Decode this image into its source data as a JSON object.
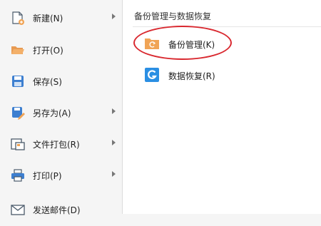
{
  "menu": {
    "items": [
      {
        "label": "新建(N)",
        "icon": "new-doc-icon",
        "has_submenu": true
      },
      {
        "label": "打开(O)",
        "icon": "open-folder-icon",
        "has_submenu": false
      },
      {
        "label": "保存(S)",
        "icon": "save-icon",
        "has_submenu": false
      },
      {
        "label": "另存为(A)",
        "icon": "save-as-icon",
        "has_submenu": true
      },
      {
        "label": "文件打包(R)",
        "icon": "package-icon",
        "has_submenu": true
      },
      {
        "label": "打印(P)",
        "icon": "print-icon",
        "has_submenu": true
      },
      {
        "label": "发送邮件(D)",
        "icon": "mail-icon",
        "has_submenu": false
      }
    ]
  },
  "panel": {
    "title": "备份管理与数据恢复",
    "items": [
      {
        "label": "备份管理(K)",
        "icon": "backup-folder-icon",
        "highlighted": true
      },
      {
        "label": "数据恢复(R)",
        "icon": "data-recovery-icon",
        "highlighted": false
      }
    ]
  },
  "colors": {
    "accent": "#2b8fe3",
    "highlight": "#d9282f",
    "folder": "#f0a456",
    "menu_bg": "#f5f5f5",
    "panel_bg": "#ffffff"
  }
}
